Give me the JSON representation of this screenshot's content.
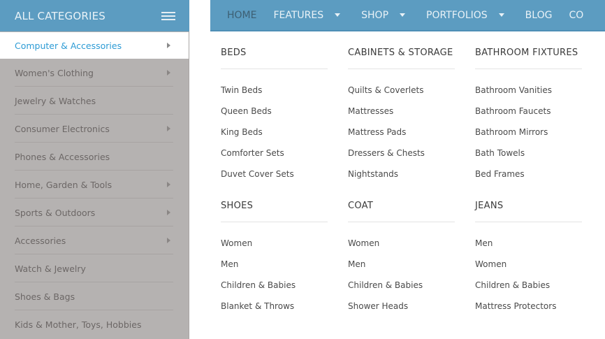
{
  "sidebar": {
    "header_title": "ALL CATEGORIES",
    "items": [
      {
        "label": "Computer & Accessories",
        "has_arrow": true,
        "active": true
      },
      {
        "label": "Women's Clothing",
        "has_arrow": true
      },
      {
        "label": "Jewelry & Watches",
        "has_arrow": false
      },
      {
        "label": "Consumer Electronics",
        "has_arrow": true
      },
      {
        "label": "Phones & Accessories",
        "has_arrow": false
      },
      {
        "label": "Home, Garden & Tools",
        "has_arrow": true
      },
      {
        "label": "Sports & Outdoors",
        "has_arrow": true
      },
      {
        "label": "Accessories",
        "has_arrow": true
      },
      {
        "label": "Watch & Jewelry",
        "has_arrow": false
      },
      {
        "label": "Shoes & Bags",
        "has_arrow": false
      },
      {
        "label": "Kids & Mother, Toys, Hobbies",
        "has_arrow": false
      }
    ]
  },
  "nav": {
    "items": [
      {
        "label": "HOME",
        "caret": false
      },
      {
        "label": "FEATURES",
        "caret": true
      },
      {
        "label": "SHOP",
        "caret": true
      },
      {
        "label": "PORTFOLIOS",
        "caret": true
      },
      {
        "label": "BLOG",
        "caret": false
      },
      {
        "label": "CO",
        "caret": false
      }
    ]
  },
  "mega_menu": {
    "rows": [
      {
        "columns": [
          {
            "title": "BEDS",
            "links": [
              "Twin Beds",
              "Queen Beds",
              "King Beds",
              "Comforter Sets",
              "Duvet Cover Sets"
            ]
          },
          {
            "title": "CABINETS & STORAGE",
            "links": [
              "Quilts & Coverlets",
              "Mattresses",
              "Mattress Pads",
              "Dressers & Chests",
              "Nightstands"
            ]
          },
          {
            "title": "BATHROOM FIXTURES",
            "links": [
              "Bathroom Vanities",
              "Bathroom Faucets",
              "Bathroom Mirrors",
              "Bath Towels",
              "Bed Frames"
            ]
          }
        ]
      },
      {
        "columns": [
          {
            "title": "SHOES",
            "links": [
              "Women",
              "Men",
              "Children & Babies",
              "Blanket & Throws"
            ]
          },
          {
            "title": "COAT",
            "links": [
              "Women",
              "Men",
              "Children & Babies",
              "Shower Heads"
            ]
          },
          {
            "title": "JEANS",
            "links": [
              "Men",
              "Women",
              "Children & Babies",
              "Mattress Protectors"
            ]
          }
        ]
      }
    ]
  },
  "colors": {
    "bar_blue": "#5c9cc1",
    "sidebar_gray": "#b5b2b1",
    "active_text": "#2c9bd5"
  }
}
